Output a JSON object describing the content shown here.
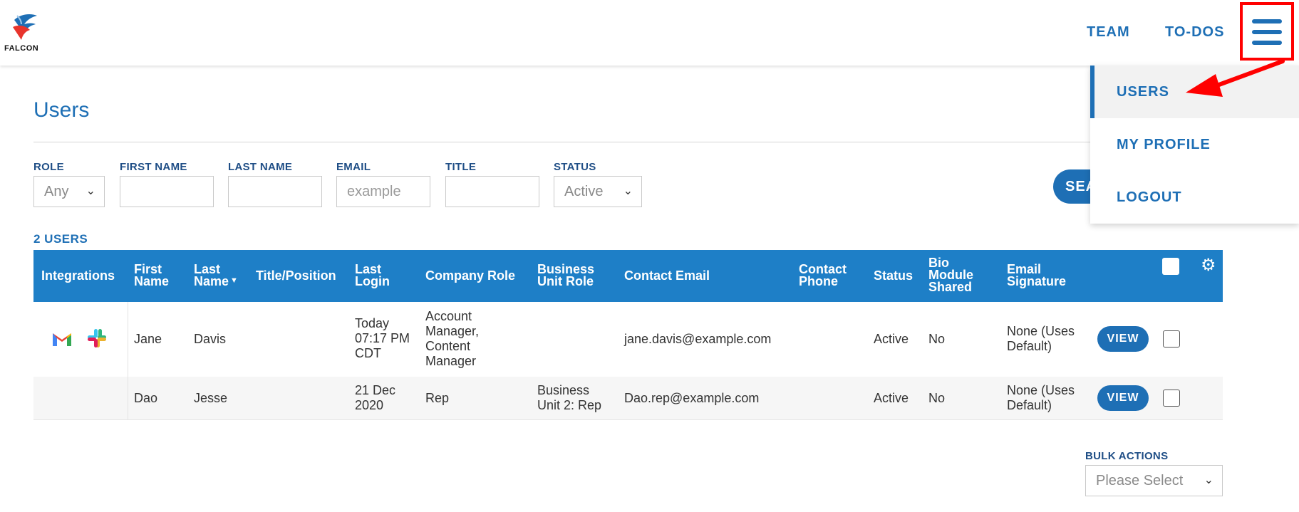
{
  "header": {
    "logo_text": "FALCON",
    "nav": {
      "team": "TEAM",
      "todos": "TO-DOS"
    },
    "menu_icon": "hamburger-icon"
  },
  "dropdown": {
    "items": [
      {
        "label": "USERS",
        "active": true
      },
      {
        "label": "MY PROFILE"
      },
      {
        "label": "LOGOUT"
      }
    ]
  },
  "page": {
    "title": "Users",
    "users_count": "2 USERS"
  },
  "filters": {
    "role": {
      "label": "ROLE",
      "value": "Any"
    },
    "first_name": {
      "label": "FIRST NAME",
      "value": ""
    },
    "last_name": {
      "label": "LAST NAME",
      "value": ""
    },
    "email": {
      "label": "EMAIL",
      "placeholder": "example"
    },
    "title": {
      "label": "TITLE",
      "value": ""
    },
    "status": {
      "label": "STATUS",
      "value": "Active"
    },
    "search_button": "SEA"
  },
  "table": {
    "headers": {
      "integrations": "Integrations",
      "first_name": [
        "First",
        "Name"
      ],
      "last_name": [
        "Last",
        "Name"
      ],
      "title_position": "Title/Position",
      "last_login": [
        "Last",
        "Login"
      ],
      "company_role": "Company Role",
      "business_unit_role": [
        "Business",
        "Unit Role"
      ],
      "contact_email": "Contact Email",
      "contact_phone": [
        "Contact",
        "Phone"
      ],
      "status": "Status",
      "bio_module_shared": [
        "Bio",
        "Module",
        "Shared"
      ],
      "email_signature": [
        "Email",
        "Signature"
      ]
    },
    "rows": [
      {
        "integrations": [
          "gmail-icon",
          "slack-icon"
        ],
        "first_name": "Jane",
        "last_name": "Davis",
        "title_position": "",
        "last_login": [
          "Today",
          "07:17 PM",
          "CDT"
        ],
        "company_role": [
          "Account",
          "Manager,",
          "Content",
          "Manager"
        ],
        "business_unit_role": "",
        "contact_email": "jane.davis@example.com",
        "contact_phone": "",
        "status": "Active",
        "bio_module_shared": "No",
        "email_signature": [
          "None (Uses",
          "Default)"
        ],
        "view_label": "VIEW"
      },
      {
        "integrations": [],
        "first_name": "Dao",
        "last_name": "Jesse",
        "title_position": "",
        "last_login": [
          "21 Dec",
          "2020"
        ],
        "company_role": [
          "Rep"
        ],
        "business_unit_role": [
          "Business",
          "Unit 2: Rep"
        ],
        "contact_email": "Dao.rep@example.com",
        "contact_phone": "",
        "status": "Active",
        "bio_module_shared": "No",
        "email_signature": [
          "None (Uses",
          "Default)"
        ],
        "view_label": "VIEW"
      }
    ]
  },
  "bulk_actions": {
    "label": "BULK ACTIONS",
    "placeholder": "Please Select"
  },
  "colors": {
    "primary": "#1e6fb5",
    "table_header": "#1e7fc7",
    "annotation": "#ff0000"
  }
}
